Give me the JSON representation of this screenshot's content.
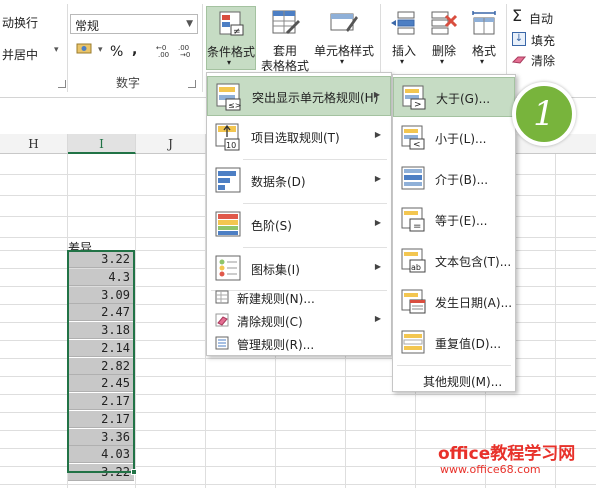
{
  "ribbon": {
    "wrap_text": "动换行",
    "merge_center": "并居中",
    "number_format": "常规",
    "percent_symbol": "%",
    "comma_symbol": ",",
    "number_group": "数字",
    "conditional_format": "条件格式",
    "table_format_line1": "套用",
    "table_format_line2": "表格格式",
    "cell_style": "单元格样式",
    "insert": "插入",
    "delete": "删除",
    "format": "格式",
    "autosum": "自动",
    "fill": "填充",
    "clear": "清除"
  },
  "sheet": {
    "columns": [
      "H",
      "I",
      "J"
    ],
    "selected_column": "I",
    "header_cell": "差异",
    "values": [
      "3.22",
      "4.3",
      "3.09",
      "2.47",
      "3.18",
      "2.14",
      "2.82",
      "2.45",
      "2.17",
      "2.17",
      "3.36",
      "4.03",
      "3.22"
    ]
  },
  "menu": {
    "items": [
      {
        "label": "突出显示单元格规则(H)",
        "highlighted": true,
        "has_submenu": true
      },
      {
        "label": "项目选取规则(T)",
        "highlighted": false,
        "has_submenu": true
      },
      {
        "label": "数据条(D)",
        "highlighted": false,
        "has_submenu": true
      },
      {
        "label": "色阶(S)",
        "highlighted": false,
        "has_submenu": true
      },
      {
        "label": "图标集(I)",
        "highlighted": false,
        "has_submenu": true
      }
    ],
    "small_items": [
      {
        "label": "新建规则(N)..."
      },
      {
        "label": "清除规则(C)"
      },
      {
        "label": "管理规则(R)..."
      }
    ]
  },
  "submenu": {
    "items": [
      {
        "label": "大于(G)...",
        "highlighted": true
      },
      {
        "label": "小于(L)..."
      },
      {
        "label": "介于(B)..."
      },
      {
        "label": "等于(E)..."
      },
      {
        "label": "文本包含(T)..."
      },
      {
        "label": "发生日期(A)..."
      },
      {
        "label": "重复值(D)..."
      }
    ],
    "more_rules": "其他规则(M)..."
  },
  "badge": "1",
  "watermark": {
    "line1": "office教程学习网",
    "line2": "www.office68.com"
  },
  "colors": {
    "highlight": "#c6dcc4",
    "excel_green": "#217346",
    "badge_green": "#78b43c",
    "watermark_red": "#e8312a"
  }
}
